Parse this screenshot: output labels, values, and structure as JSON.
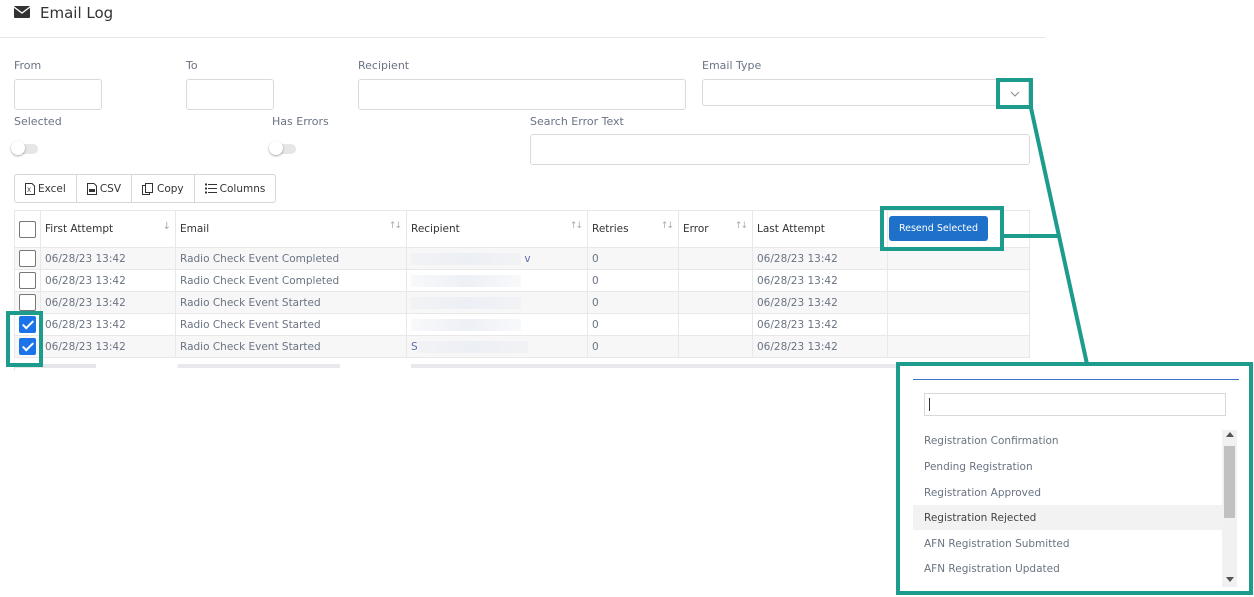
{
  "header": {
    "title": "Email Log",
    "icon": "envelope-icon"
  },
  "filters": {
    "from_label": "From",
    "to_label": "To",
    "recipient_label": "Recipient",
    "email_type_label": "Email Type",
    "selected_label": "Selected",
    "has_errors_label": "Has Errors",
    "search_error_label": "Search Error Text"
  },
  "toolbar": {
    "excel": "Excel",
    "csv": "CSV",
    "copy": "Copy",
    "columns": "Columns"
  },
  "table": {
    "columns": [
      "First Attempt",
      "Email",
      "Recipient",
      "Retries",
      "Error",
      "Last Attempt"
    ],
    "rows": [
      {
        "first": "06/28/23 13:42",
        "email": "Radio Check Event Completed",
        "recipient": "v",
        "retries": "0",
        "error": "",
        "last": "06/28/23 13:42",
        "checked": false
      },
      {
        "first": "06/28/23 13:42",
        "email": "Radio Check Event Completed",
        "recipient": "",
        "retries": "0",
        "error": "",
        "last": "06/28/23 13:42",
        "checked": false
      },
      {
        "first": "06/28/23 13:42",
        "email": "Radio Check Event Started",
        "recipient": "",
        "retries": "0",
        "error": "",
        "last": "06/28/23 13:42",
        "checked": false
      },
      {
        "first": "06/28/23 13:42",
        "email": "Radio Check Event Started",
        "recipient": "",
        "retries": "0",
        "error": "",
        "last": "06/28/23 13:42",
        "checked": true
      },
      {
        "first": "06/28/23 13:42",
        "email": "Radio Check Event Started",
        "recipient": "S",
        "retries": "0",
        "error": "",
        "last": "06/28/23 13:42",
        "checked": true
      }
    ]
  },
  "resend_button": "Resend Selected",
  "dropdown": {
    "items": [
      "Registration Confirmation",
      "Pending Registration",
      "Registration Approved",
      "Registration Rejected",
      "AFN Registration Submitted",
      "AFN Registration Updated"
    ],
    "active_index": 3
  },
  "colors": {
    "highlight": "#1d9b8c",
    "primary": "#1e70c9",
    "checkbox": "#1a73e8"
  }
}
